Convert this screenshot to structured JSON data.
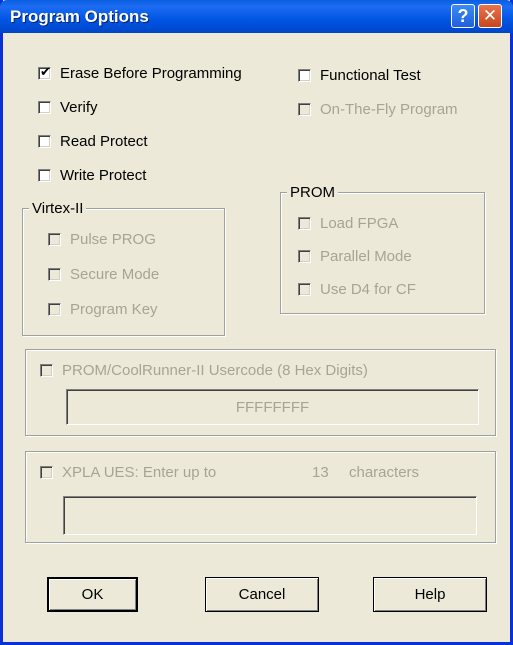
{
  "window": {
    "title": "Program Options",
    "help_glyph": "?",
    "close_glyph": "✕"
  },
  "options": {
    "erase_before_programming": {
      "label": "Erase Before Programming",
      "checked": true,
      "enabled": true
    },
    "verify": {
      "label": "Verify",
      "checked": false,
      "enabled": true
    },
    "read_protect": {
      "label": "Read Protect",
      "checked": false,
      "enabled": true
    },
    "write_protect": {
      "label": "Write Protect",
      "checked": false,
      "enabled": true
    },
    "functional_test": {
      "label": "Functional Test",
      "checked": false,
      "enabled": true
    },
    "on_the_fly_program": {
      "label": "On-The-Fly Program",
      "checked": false,
      "enabled": false
    }
  },
  "virtex2": {
    "title": "Virtex-II",
    "pulse_prog": "Pulse PROG",
    "secure_mode": "Secure Mode",
    "program_key": "Program Key"
  },
  "prom": {
    "title": "PROM",
    "load_fpga": "Load FPGA",
    "parallel_mode": "Parallel Mode",
    "use_d4_for_cf": "Use D4 for CF"
  },
  "usercode": {
    "label": "PROM/CoolRunner-II Usercode (8 Hex Digits)",
    "value": "FFFFFFFF"
  },
  "xpla": {
    "label": "XPLA UES: Enter up to",
    "count": "13",
    "suffix": "characters",
    "value": ""
  },
  "buttons": {
    "ok": "OK",
    "cancel": "Cancel",
    "help": "Help"
  },
  "colors": {
    "title_bar": "#0055e5",
    "dialog_bg": "#ece9d8",
    "disabled_text": "#a7a492"
  }
}
